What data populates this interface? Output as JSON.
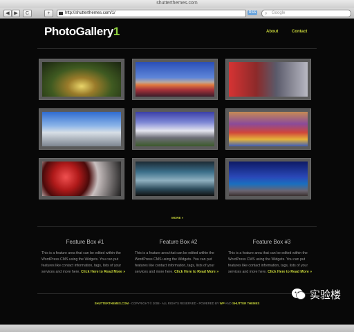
{
  "window": {
    "title": "shutterthemes.com"
  },
  "toolbar": {
    "back": "◀",
    "forward": "▶",
    "reload": "C",
    "add": "+",
    "url": "http://shutterthemes.com/1/",
    "rss": "RSS",
    "search_placeholder": "Google"
  },
  "site": {
    "logo_text": "PhotoGallery",
    "logo_num": "1",
    "nav": [
      "About",
      "Contact"
    ],
    "more": "MORE »"
  },
  "gallery": [
    "tunnel-photo",
    "mountain-lake-photo",
    "fire-truck-photo",
    "pier-photo",
    "house-photo",
    "crowd-photo",
    "red-bowls-photo",
    "metal-tank-photo",
    "night-coast-photo"
  ],
  "features": [
    {
      "title": "Feature Box #1",
      "text": "This is a feature area that can be edited within the WordPress CMS using the Widgets. You can put features like contact information, tags, lists of your services and more here.",
      "link": "Click Here to Read More »"
    },
    {
      "title": "Feature Box #2",
      "text": "This is a feature area that can be edited within the WordPress CMS using the Widgets. You can put features like contact information, tags, lists of your services and more here.",
      "link": "Click Here to Read More »"
    },
    {
      "title": "Feature Box #3",
      "text": "This is a feature area that can be edited within the WordPress CMS using the Widgets. You can put features like contact information, tags, lists of your services and more here.",
      "link": "Click Here to Read More »"
    }
  ],
  "footer": {
    "site": "SHUTTERTHEMES.COM",
    "copyright": " - COPYRIGHT © 2008 - ALL RIGHTS RESERVED - POWERED BY ",
    "wp": "WP",
    "and": " AND ",
    "themes": "SHUTTER THEMES"
  },
  "watermark": {
    "text": "实验楼"
  },
  "colors": {
    "accent": "#c8d63a",
    "logo_num": "#8fd13f",
    "page_bg": "#080808"
  }
}
